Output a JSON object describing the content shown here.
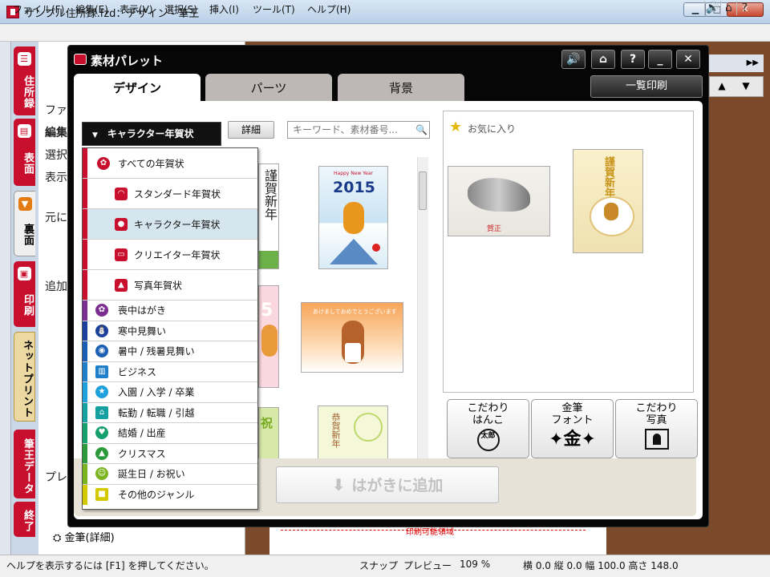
{
  "window": {
    "title": "サンプル住所録.fzd：デザイン - 筆王",
    "controls": {
      "minimize": "▁",
      "maximize": "□",
      "close": "✕"
    }
  },
  "menubar": {
    "items": [
      "ファイル(F)",
      "編集(E)",
      "表示(V)",
      "選択(S)",
      "挿入(I)",
      "ツール(T)",
      "ヘルプ(H)"
    ],
    "right_icons": [
      "speaker-icon",
      "book-icon",
      "help-icon"
    ]
  },
  "side_tabs": {
    "jusho": "住所録",
    "omote": "表面",
    "ura": "裏面",
    "insatsu": "印刷",
    "net": "ネットプリント",
    "data": "筆王データ",
    "end": "終了"
  },
  "background_panel": {
    "items": [
      "ファ",
      "編集",
      "選択",
      "表示",
      "元に",
      "追加",
      "プレ"
    ],
    "kinpitsu": "金筆(詳細)"
  },
  "canvas": {
    "print_area_label": "印刷可能領域"
  },
  "palette": {
    "title": "素材パレット",
    "title_icons": [
      "speaker-icon",
      "book-icon",
      "help-icon",
      "minimize-icon",
      "close-icon"
    ],
    "tabs": [
      "デザイン",
      "パーツ",
      "背景"
    ],
    "active_tab": "デザイン",
    "list_print_button": "一覧印刷",
    "category_dropdown": "キャラクター年賀状",
    "detail_button": "詳細",
    "search_placeholder": "キーワード、素材番号...",
    "categories": [
      {
        "label": "すべての年賀状",
        "color": "#c8102e",
        "icon": "flower-icon"
      },
      {
        "label": "スタンダード年賀状",
        "color": "#c8102e",
        "icon": "fan-icon"
      },
      {
        "label": "キャラクター年賀状",
        "color": "#c8102e",
        "icon": "bear-icon",
        "selected": true
      },
      {
        "label": "クリエイター年賀状",
        "color": "#c8102e",
        "icon": "easel-icon"
      },
      {
        "label": "写真年賀状",
        "color": "#c8102e",
        "icon": "photo-icon"
      },
      {
        "label": "喪中はがき",
        "color": "#7b2e8f",
        "icon": "chrysanthemum-icon"
      },
      {
        "label": "寒中見舞い",
        "color": "#1b3f9c",
        "icon": "snowman-icon"
      },
      {
        "label": "暑中 / 残暑見舞い",
        "color": "#1a5fb4",
        "icon": "uchiwa-icon"
      },
      {
        "label": "ビジネス",
        "color": "#1f7fc8",
        "icon": "building-icon"
      },
      {
        "label": "入園 / 入学 / 卒業",
        "color": "#1ea0dc",
        "icon": "star-icon"
      },
      {
        "label": "転勤 / 転職 / 引越",
        "color": "#14a0a0",
        "icon": "house-icon"
      },
      {
        "label": "結婚 / 出産",
        "color": "#16a06e",
        "icon": "heart-icon"
      },
      {
        "label": "クリスマス",
        "color": "#2a9a3a",
        "icon": "tree-icon"
      },
      {
        "label": "誕生日 / お祝い",
        "color": "#7ab41e",
        "icon": "smile-icon"
      },
      {
        "label": "その他のジャンル",
        "color": "#d4c800",
        "icon": "shapes-icon"
      }
    ],
    "thumbnails": {
      "happy_new_year": "Happy New Year",
      "year": "2015",
      "kinga_shinnen": "謹賀新年",
      "pink_partial": "5",
      "greeting_small": "あけましておめでとうございます",
      "shuku_partial": "祝",
      "geiga_shinnen": "恭賀新年"
    },
    "favorites": {
      "title": "お気に入り",
      "horse_caption": "賀正",
      "sheep_caption": "謹賀新年"
    },
    "feature_buttons": [
      {
        "label1": "こだわり",
        "label2": "はんこ",
        "symbol": "太郎"
      },
      {
        "label1": "金筆",
        "label2": "フォント",
        "symbol": "✦金✦"
      },
      {
        "label1": "こだわり",
        "label2": "写真",
        "symbol": ""
      }
    ],
    "add_button": "はがきに追加"
  },
  "statusbar": {
    "help": "ヘルプを表示するには [F1] を押してください。",
    "snap": "スナップ",
    "preview": "プレビュー",
    "zoom": "109 %",
    "geometry": "横 0.0 縦 0.0 幅 100.0 高さ 148.0"
  }
}
